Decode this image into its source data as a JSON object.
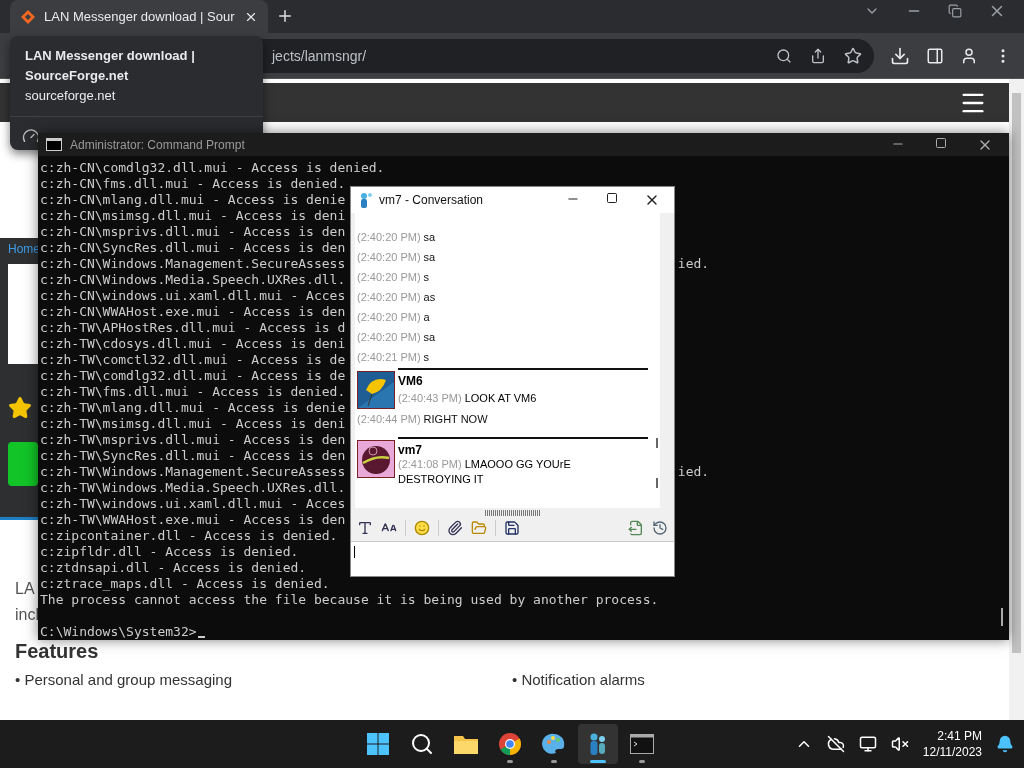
{
  "browser": {
    "tab": {
      "title": "LAN Messenger download | Sour",
      "selected": true
    },
    "tooltip": {
      "title": "LAN Messenger download | SourceForge.net",
      "domain": "sourceforge.net"
    },
    "address": "jects/lanmsngr/",
    "page": {
      "breadcrumb": "Home",
      "intro_lines": [
        "LA",
        "incl"
      ],
      "features_heading": "Features",
      "features": [
        "• Personal and group messaging",
        "• Notification alarms"
      ]
    }
  },
  "console": {
    "title": "Administrator: Command Prompt",
    "lines": [
      {
        "text": "c:zh-CN\\comdlg32.dll.mui - Access is denied."
      },
      {
        "text": "c:zh-CN\\fms.dll.mui - Access is denied."
      },
      {
        "text": "c:zh-CN\\mlang.dll.mui - Access is denie"
      },
      {
        "text": "c:zh-CN\\msimsg.dll.mui - Access is deni"
      },
      {
        "text": "c:zh-CN\\msprivs.dll.mui - Access is den"
      },
      {
        "text": "c:zh-CN\\SyncRes.dll.mui - Access is den"
      },
      {
        "text": "c:zh-CN\\Windows.Management.SecureAssess",
        "tail": "ied."
      },
      {
        "text": "c:zh-CN\\Windows.Media.Speech.UXRes.dll."
      },
      {
        "text": "c:zh-CN\\windows.ui.xaml.dll.mui - Acces"
      },
      {
        "text": "c:zh-CN\\WWAHost.exe.mui - Access is den"
      },
      {
        "text": "c:zh-TW\\APHostRes.dll.mui - Access is d"
      },
      {
        "text": "c:zh-TW\\cdosys.dll.mui - Access is deni"
      },
      {
        "text": "c:zh-TW\\comctl32.dll.mui - Access is de"
      },
      {
        "text": "c:zh-TW\\comdlg32.dll.mui - Access is de"
      },
      {
        "text": "c:zh-TW\\fms.dll.mui - Access is denied."
      },
      {
        "text": "c:zh-TW\\mlang.dll.mui - Access is denie"
      },
      {
        "text": "c:zh-TW\\msimsg.dll.mui - Access is deni"
      },
      {
        "text": "c:zh-TW\\msprivs.dll.mui - Access is den"
      },
      {
        "text": "c:zh-TW\\SyncRes.dll.mui - Access is den"
      },
      {
        "text": "c:zh-TW\\Windows.Management.SecureAssess",
        "tail": "ied."
      },
      {
        "text": "c:zh-TW\\Windows.Media.Speech.UXRes.dll."
      },
      {
        "text": "c:zh-TW\\windows.ui.xaml.dll.mui - Acces"
      },
      {
        "text": "c:zh-TW\\WWAHost.exe.mui - Access is den"
      },
      {
        "text": "c:zipcontainer.dll - Access is denied."
      },
      {
        "text": "c:zipfldr.dll - Access is denied."
      },
      {
        "text": "c:ztdnsapi.dll - Access is denied."
      },
      {
        "text": "c:ztrace_maps.dll - Access is denied."
      },
      {
        "text": "The process cannot access the file because it is being used by another process."
      }
    ],
    "prompt": "C:\\Windows\\System32>"
  },
  "chat": {
    "title": "vm7 - Conversation",
    "lines": [
      {
        "time": "(2:40:20 PM)",
        "text": "sa"
      },
      {
        "time": "(2:40:20 PM)",
        "text": "sa"
      },
      {
        "time": "(2:40:20 PM)",
        "text": "s"
      },
      {
        "time": "(2:40:20 PM)",
        "text": "as"
      },
      {
        "time": "(2:40:20 PM)",
        "text": "a"
      },
      {
        "time": "(2:40:20 PM)",
        "text": "sa"
      },
      {
        "time": "(2:40:21 PM)",
        "text": "s"
      }
    ],
    "blocks": [
      {
        "sender": "VM6",
        "kind": "flower",
        "messages": [
          {
            "time": "(2:40:43 PM)",
            "text": "LOOK AT VM6"
          }
        ],
        "followups": [
          {
            "time": "(2:40:44 PM)",
            "text": "RIGHT NOW"
          }
        ]
      },
      {
        "sender": "vm7",
        "kind": "ball",
        "messages": [
          {
            "time": "(2:41:08 PM)",
            "text": "LMAOOO GG YOUrE DESTROYING IT"
          }
        ]
      }
    ]
  },
  "taskbar": {
    "apps": [
      {
        "kind": "start",
        "selected": false,
        "running": false
      },
      {
        "kind": "search",
        "selected": false,
        "running": false
      },
      {
        "kind": "files",
        "selected": false,
        "running": false
      },
      {
        "kind": "chrome",
        "selected": false,
        "running": true
      },
      {
        "kind": "paint",
        "selected": false,
        "running": true
      },
      {
        "kind": "messenger",
        "selected": true,
        "running": true
      },
      {
        "kind": "terminal",
        "selected": false,
        "running": true
      }
    ],
    "time": "2:41 PM",
    "date": "12/11/2023"
  }
}
